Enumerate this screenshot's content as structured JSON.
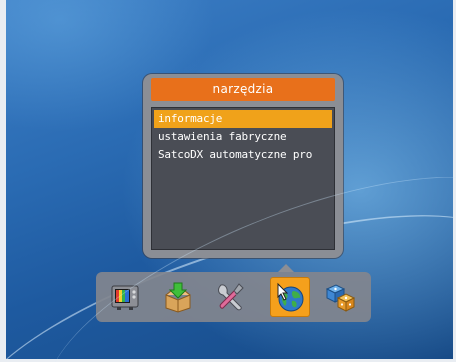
{
  "menu": {
    "title": "narzędzia",
    "items": [
      {
        "label": "informacje",
        "selected": true
      },
      {
        "label": "ustawienia fabryczne",
        "selected": false
      },
      {
        "label": "SatcoDX automatyczne pro",
        "selected": false
      }
    ]
  },
  "toolbar": {
    "icons": [
      {
        "name": "tv-icon",
        "active": false
      },
      {
        "name": "install-box-icon",
        "active": false
      },
      {
        "name": "tools-icon",
        "active": true
      },
      {
        "name": "globe-cursor-icon",
        "active": false
      },
      {
        "name": "games-dice-icon",
        "active": false
      }
    ]
  },
  "colors": {
    "title_bar": "#e8701b",
    "selection": "#f0a21a",
    "panel": "#8b8e95",
    "list_bg": "#4a4d55"
  }
}
